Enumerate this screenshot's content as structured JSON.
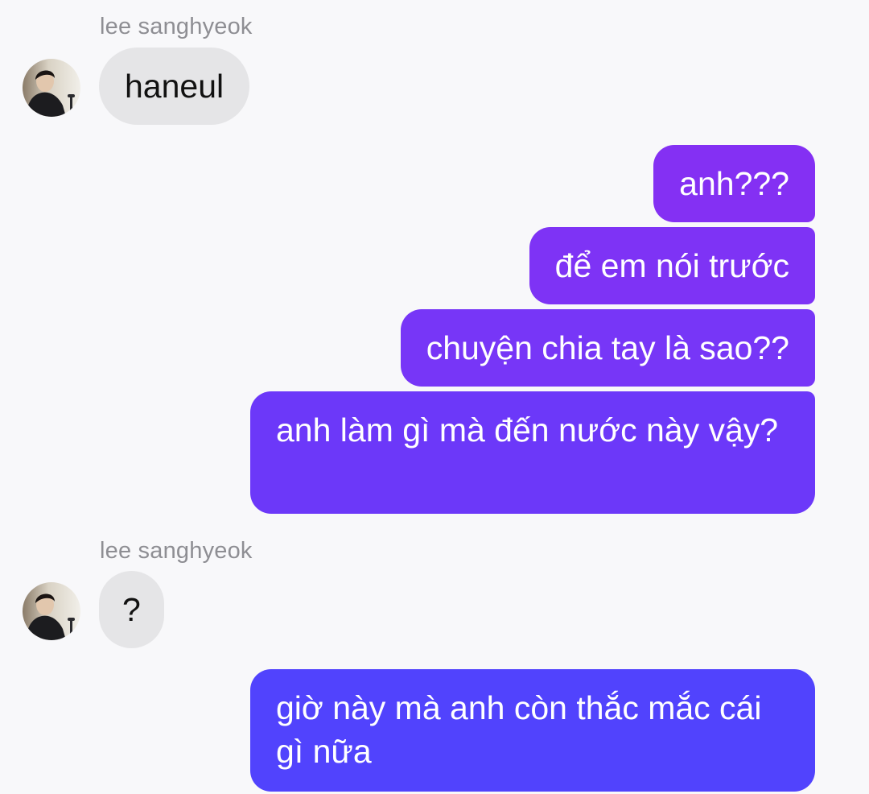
{
  "conversation": {
    "contact_name": "lee sanghyeok",
    "contact_avatar_icon": "profile-photo-icon",
    "theme": {
      "incoming_bubble": "#e5e5e7",
      "outgoing_gradient_top": "#8a2bf5",
      "outgoing_gradient_bottom": "#4a4cff"
    },
    "messages": [
      {
        "direction": "incoming",
        "sender": "lee sanghyeok",
        "text": "haneul"
      },
      {
        "direction": "outgoing",
        "text": "anh???"
      },
      {
        "direction": "outgoing",
        "text": "để em nói trước"
      },
      {
        "direction": "outgoing",
        "text": "chuyện chia tay là sao??"
      },
      {
        "direction": "outgoing",
        "text": "anh làm gì mà đến nước này vậy?"
      },
      {
        "direction": "incoming",
        "sender": "lee sanghyeok",
        "text": "?"
      },
      {
        "direction": "outgoing",
        "text": "giờ này mà anh còn thắc mắc cái gì nữa"
      }
    ]
  }
}
